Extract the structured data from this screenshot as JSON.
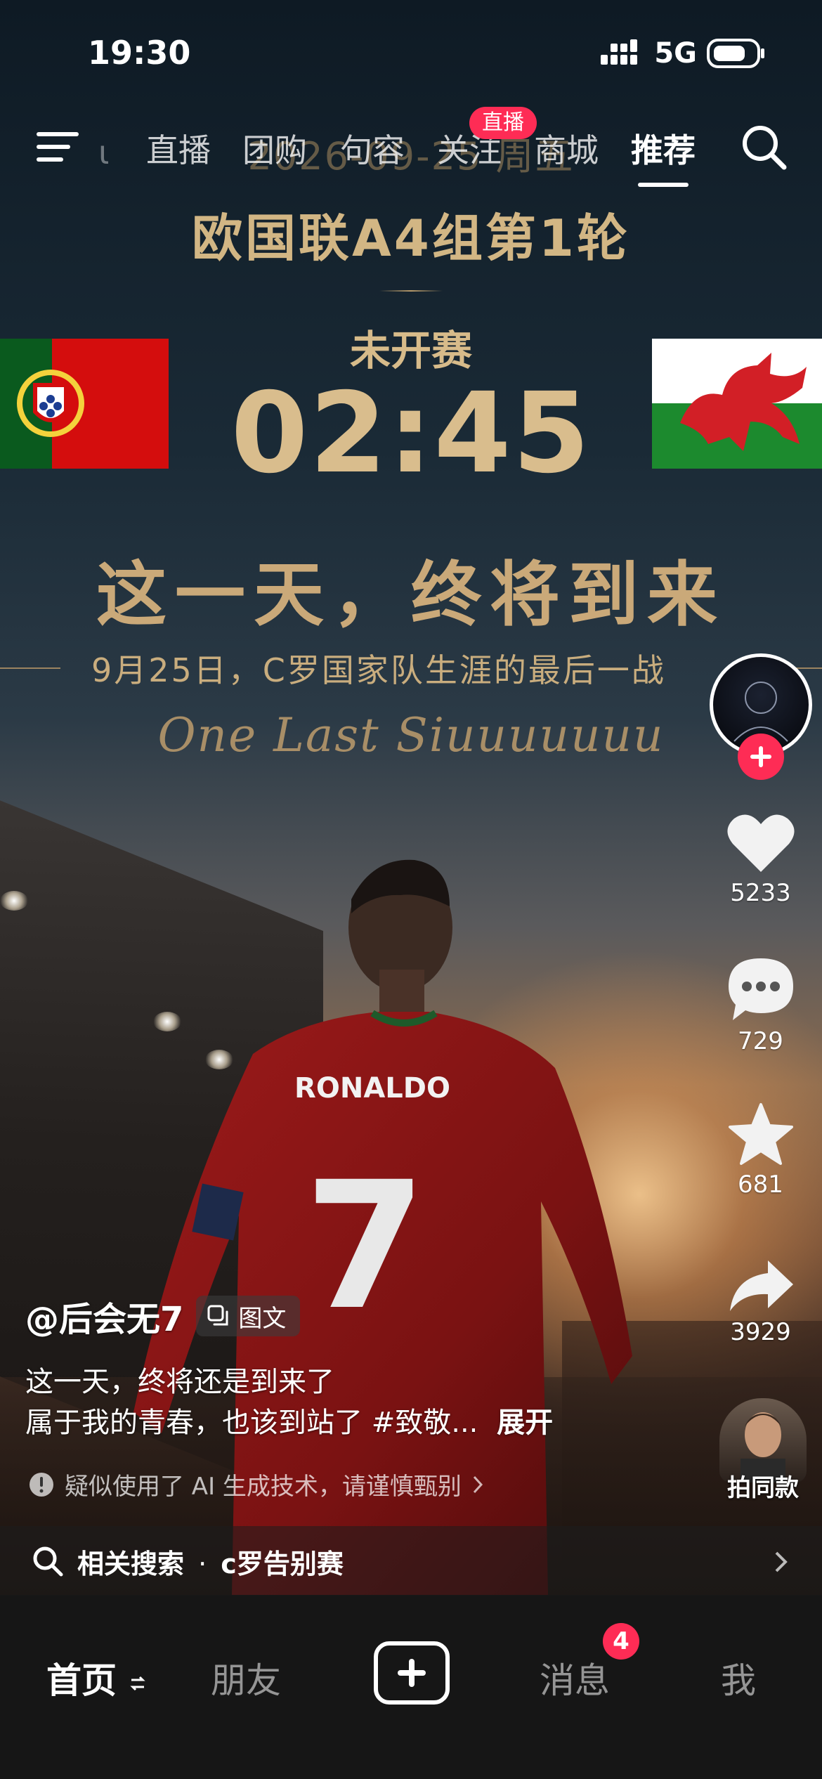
{
  "status_bar": {
    "time": "19:30",
    "network": "5G"
  },
  "top_nav": {
    "tabs": [
      {
        "label": "直播"
      },
      {
        "label": "团购"
      },
      {
        "label": "句容"
      },
      {
        "label": "关注"
      },
      {
        "label": "商城"
      },
      {
        "label": "推荐"
      }
    ],
    "active_tab": "推荐",
    "live_badge": "直播"
  },
  "poster": {
    "date": "2026-09-25 周五",
    "match": "欧国联A4组第1轮",
    "status": "未开赛",
    "kickoff_time": "02:45",
    "slogan": "这一天，终将到来",
    "subtitle": "9月25日，C罗国家队生涯的最后一战",
    "script_line": "One Last Siuuuuuuu",
    "jersey_name": "RONALDO",
    "jersey_number": "7"
  },
  "actions": {
    "likes": "5233",
    "comments": "729",
    "favorites": "681",
    "shares": "3929",
    "same_style_label": "拍同款"
  },
  "post": {
    "author": "@后会无7",
    "type_badge": "图文",
    "caption_line1": "这一天，终将还是到来了",
    "caption_line2": "属于我的青春，也该到站了 #致敬...",
    "expand_label": "展开",
    "ai_notice": "疑似使用了 AI 生成技术，请谨慎甄别"
  },
  "related_search": {
    "prefix": "相关搜索",
    "separator": "·",
    "keyword": "c罗告别赛"
  },
  "bottom_tabs": {
    "home": "首页",
    "friends": "朋友",
    "messages": "消息",
    "messages_badge": "4",
    "me": "我"
  },
  "colors": {
    "accent": "#fe2c55",
    "gold_text": "#d7bb8a",
    "tab_bar_bg": "#161616"
  }
}
